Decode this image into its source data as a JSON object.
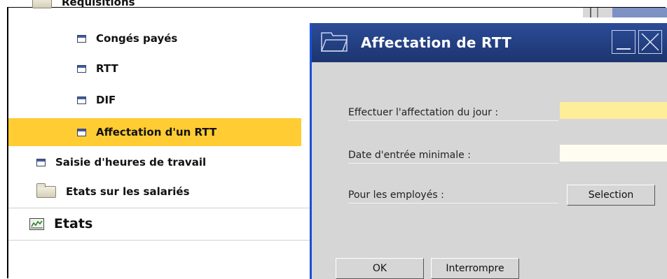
{
  "nav": {
    "requisitions_label": "Réquisitions",
    "items": [
      {
        "label": "Congés payés"
      },
      {
        "label": "RTT"
      },
      {
        "label": "DIF"
      },
      {
        "label": "Affectation d'un RTT"
      },
      {
        "label": "Saisie d'heures de travail"
      },
      {
        "label": "Etats sur les salariés"
      },
      {
        "label": "Etats"
      }
    ]
  },
  "dialog": {
    "title": "Affectation de RTT",
    "fields": {
      "assign_day_label": "Effectuer l'affectation du jour :",
      "assign_day_value": "",
      "min_entry_date_label": "Date d'entrée minimale :",
      "min_entry_date_value": "",
      "employees_label": "Pour les employés :",
      "selection_button": "Selection"
    },
    "buttons": {
      "ok": "OK",
      "cancel": "Interrompre"
    }
  },
  "colors": {
    "selected_row": "#ffcc33",
    "titlebar": "#233f80",
    "dialog_bg": "#d6d6d6",
    "input_required": "#ffee99",
    "input_normal": "#fffdf2",
    "accent_border": "#1a4fd6"
  }
}
